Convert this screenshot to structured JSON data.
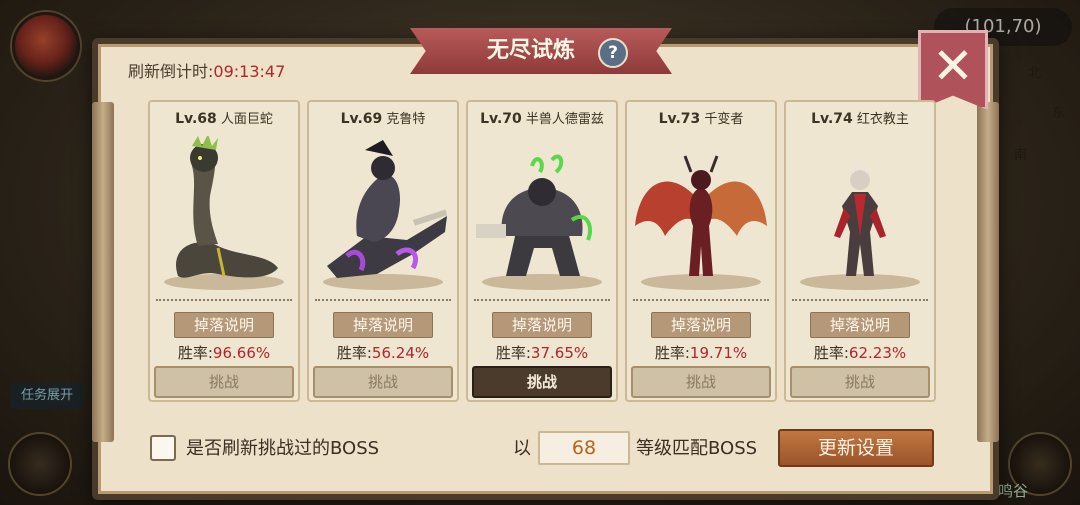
{
  "background": {
    "coords": "(101,70)",
    "compass_north": "北",
    "compass_east": "东",
    "compass_south": "南",
    "task_toggle": "任务展开",
    "area_label": "绿鸣谷"
  },
  "dialog": {
    "title": "无尽试炼",
    "help": "?",
    "close": "✕",
    "countdown_label": "刷新倒计时:",
    "countdown_time": "09:13:47",
    "bosses": [
      {
        "level": "Lv.68",
        "name": "人面巨蛇",
        "drop_label": "掉落说明",
        "winrate_label": "胜率:",
        "winrate": "96.66%",
        "challenge_label": "挑战",
        "selected": false,
        "icon": "serpent-boss-icon"
      },
      {
        "level": "Lv.69",
        "name": "克鲁特",
        "drop_label": "掉落说明",
        "winrate_label": "胜率:",
        "winrate": "56.24%",
        "challenge_label": "挑战",
        "selected": false,
        "icon": "rider-boss-icon"
      },
      {
        "level": "Lv.70",
        "name": "半兽人德雷兹",
        "drop_label": "掉落说明",
        "winrate_label": "胜率:",
        "winrate": "37.65%",
        "challenge_label": "挑战",
        "selected": true,
        "icon": "orc-boss-icon"
      },
      {
        "level": "Lv.73",
        "name": "千变者",
        "drop_label": "掉落说明",
        "winrate_label": "胜率:",
        "winrate": "19.71%",
        "challenge_label": "挑战",
        "selected": false,
        "icon": "demon-boss-icon"
      },
      {
        "level": "Lv.74",
        "name": "红衣教主",
        "drop_label": "掉落说明",
        "winrate_label": "胜率:",
        "winrate": "62.23%",
        "challenge_label": "挑战",
        "selected": false,
        "icon": "cardinal-boss-icon"
      }
    ],
    "footer": {
      "refresh_checkbox_label": "是否刷新挑战过的BOSS",
      "refresh_checked": false,
      "match_prefix": "以",
      "match_level": "68",
      "match_suffix": "等级匹配BOSS",
      "update_button": "更新设置"
    }
  },
  "colors": {
    "accent_red": "#b0262a",
    "ribbon": "#8e3a3a",
    "update_button": "#b0653a"
  }
}
